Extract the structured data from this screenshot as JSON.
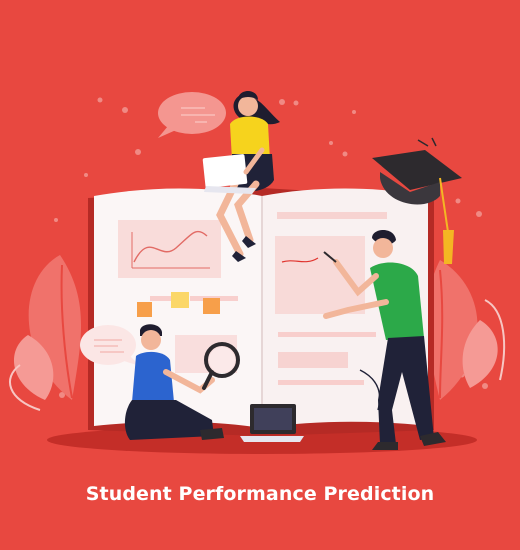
{
  "title": "Student Performance Prediction",
  "colors": {
    "background": "#e84840",
    "book_page": "#fbf6f6",
    "book_cover": "#d3322c",
    "accent_light": "#f7c6c3",
    "shirt_yellow": "#f6d31d",
    "shirt_green": "#2ca949",
    "shirt_blue": "#2c64cf",
    "pants_navy": "#202238",
    "cap": "#2d2a2e",
    "tassel": "#f4b623",
    "sticky_orange": "#f79f4a",
    "sticky_yellow": "#fbd768",
    "text": "#ffffff"
  },
  "illustration": {
    "figures": [
      "girl-with-laptop",
      "man-pointing-pen",
      "boy-with-magnifier"
    ],
    "icons": [
      "graduation-cap-icon",
      "laptop-icon",
      "magnifying-glass-icon",
      "speech-bubble-icon",
      "line-chart-icon",
      "leaf-icon"
    ]
  }
}
